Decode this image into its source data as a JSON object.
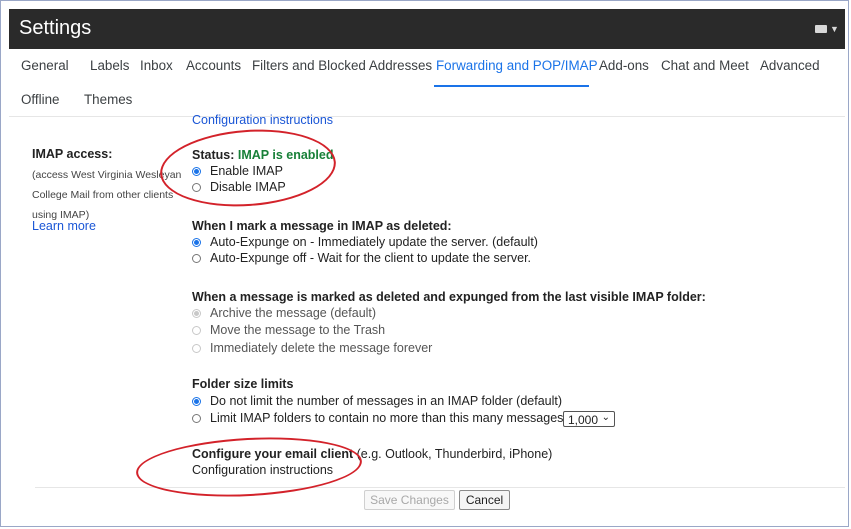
{
  "header": {
    "title": "Settings",
    "account_icon": "account-switcher-icon"
  },
  "tabs": [
    {
      "label": "General"
    },
    {
      "label": "Labels"
    },
    {
      "label": "Inbox"
    },
    {
      "label": "Accounts"
    },
    {
      "label": "Filters and Blocked Addresses"
    },
    {
      "label": "Forwarding and POP/IMAP"
    },
    {
      "label": "Add-ons"
    },
    {
      "label": "Chat and Meet"
    },
    {
      "label": "Advanced"
    }
  ],
  "tabs_row2": [
    {
      "label": "Offline"
    },
    {
      "label": "Themes"
    }
  ],
  "top_config_link": "Configuration instructions",
  "imap_access": {
    "label": "IMAP access:",
    "desc_line1": "(access West Virginia Wesleyan",
    "desc_line2": "College Mail from other clients",
    "desc_line3": "using IMAP)",
    "learn_more": "Learn more",
    "status_label": "Status: ",
    "status_value": "IMAP is enabled",
    "enable": "Enable IMAP",
    "disable": "Disable IMAP"
  },
  "deleted": {
    "heading": "When I mark a message in IMAP as deleted:",
    "opt_on": "Auto-Expunge on - Immediately update the server. (default)",
    "opt_off": "Auto-Expunge off - Wait for the client to update the server."
  },
  "expunged": {
    "heading": "When a message is marked as deleted and expunged from the last visible IMAP folder:",
    "opt_archive": "Archive the message (default)",
    "opt_trash": "Move the message to the Trash",
    "opt_delete": "Immediately delete the message forever"
  },
  "folder_size": {
    "heading": "Folder size limits",
    "opt_nolimit": "Do not limit the number of messages in an IMAP folder (default)",
    "opt_limit": "Limit IMAP folders to contain no more than this many messages",
    "limit_value": "1,000"
  },
  "configure": {
    "heading": "Configure your email client",
    "note": " (e.g. Outlook, Thunderbird, iPhone)",
    "link": "Configuration instructions"
  },
  "buttons": {
    "save": "Save Changes",
    "cancel": "Cancel"
  },
  "colors": {
    "accent": "#1a73e8",
    "status_green": "#188038",
    "annotation_red": "#d3222a",
    "header_bg": "#2a2a2a"
  }
}
